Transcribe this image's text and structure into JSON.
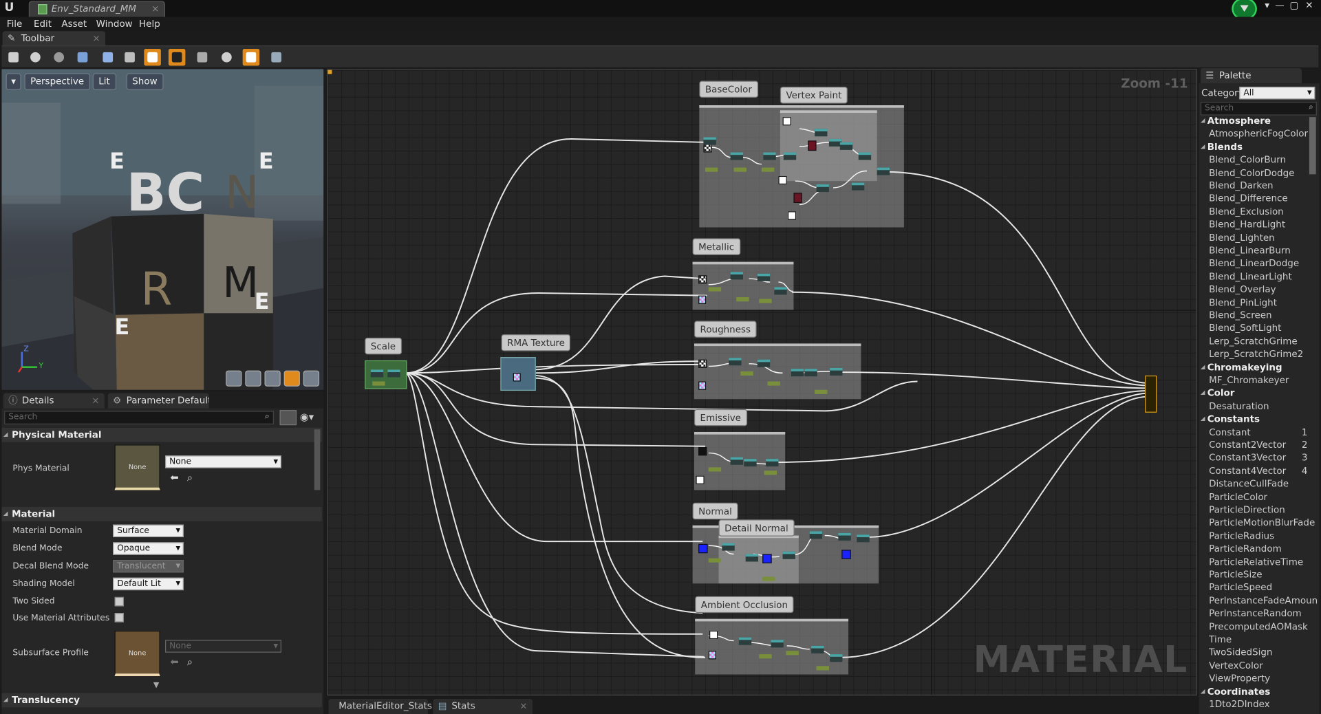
{
  "window": {
    "tab_title": "Env_Standard_MM",
    "controls": [
      "▾",
      "—",
      "▢",
      "✕"
    ]
  },
  "menu": [
    "File",
    "Edit",
    "Asset",
    "Window",
    "Help"
  ],
  "toolbar_tab": "Toolbar",
  "toolbar_buttons": [
    "save",
    "browse",
    "apply",
    "search",
    "home",
    "clean-up",
    "connectors",
    "live-preview",
    "live-nodes",
    "live-update",
    "stats",
    "platform-stats"
  ],
  "viewport": {
    "buttons": {
      "perspective": "Perspective",
      "lit": "Lit",
      "show": "Show"
    },
    "cube_letters": {
      "bc": "BC",
      "n": "N",
      "r": "R",
      "m": "M",
      "e": "E"
    },
    "axis": {
      "z": "Z",
      "y": "Y"
    }
  },
  "details": {
    "tabs": {
      "details": "Details",
      "param": "Parameter Defaults"
    },
    "search_placeholder": "Search",
    "physical_material_header": "Physical Material",
    "phys_material_label": "Phys Material",
    "phys_material_thumb": "None",
    "phys_material_value": "None",
    "material_header": "Material",
    "rows": [
      {
        "label": "Material Domain",
        "value": "Surface"
      },
      {
        "label": "Blend Mode",
        "value": "Opaque"
      },
      {
        "label": "Decal Blend Mode",
        "value": "Translucent"
      },
      {
        "label": "Shading Model",
        "value": "Default Lit"
      }
    ],
    "two_sided_label": "Two Sided",
    "use_material_attributes_label": "Use Material Attributes",
    "subsurface_label": "Subsurface Profile",
    "subsurface_thumb": "None",
    "subsurface_value": "None",
    "translucency_header": "Translucency"
  },
  "graph": {
    "zoom_label": "Zoom -11",
    "watermark": "MATERIAL",
    "labels": {
      "basecolor": "BaseColor",
      "vertexpaint": "Vertex Paint",
      "metallic": "Metallic",
      "roughness": "Roughness",
      "emissive": "Emissive",
      "normal": "Normal",
      "detailnormal": "Detail Normal",
      "ao": "Ambient Occlusion",
      "scale": "Scale",
      "rma": "RMA Texture"
    }
  },
  "bottom_tabs": {
    "stats_editor": "MaterialEditor_Stats",
    "stats": "Stats"
  },
  "palette": {
    "tab": "Palette",
    "category_label": "Category:",
    "category_value": "All",
    "search_placeholder": "Search",
    "groups": [
      {
        "name": "Atmosphere",
        "items": [
          "AtmosphericFogColor"
        ]
      },
      {
        "name": "Blends",
        "items": [
          "Blend_ColorBurn",
          "Blend_ColorDodge",
          "Blend_Darken",
          "Blend_Difference",
          "Blend_Exclusion",
          "Blend_HardLight",
          "Blend_Lighten",
          "Blend_LinearBurn",
          "Blend_LinearDodge",
          "Blend_LinearLight",
          "Blend_Overlay",
          "Blend_PinLight",
          "Blend_Screen",
          "Blend_SoftLight",
          "Lerp_ScratchGrime",
          "Lerp_ScratchGrime2"
        ]
      },
      {
        "name": "Chromakeying",
        "items": [
          "MF_Chromakeyer"
        ]
      },
      {
        "name": "Color",
        "items": [
          "Desaturation"
        ]
      },
      {
        "name": "Constants",
        "items": [
          "Constant",
          "Constant2Vector",
          "Constant3Vector",
          "Constant4Vector",
          "DistanceCullFade",
          "ParticleColor",
          "ParticleDirection",
          "ParticleMotionBlurFade",
          "ParticleRadius",
          "ParticleRandom",
          "ParticleRelativeTime",
          "ParticleSize",
          "ParticleSpeed",
          "PerInstanceFadeAmoun",
          "PerInstanceRandom",
          "PrecomputedAOMask",
          "Time",
          "TwoSidedSign",
          "VertexColor",
          "ViewProperty"
        ]
      },
      {
        "name": "Coordinates",
        "items": [
          "1Dto2DIndex"
        ]
      }
    ],
    "shortcuts": {
      "Constant": "1",
      "Constant2Vector": "2",
      "Constant3Vector": "3",
      "Constant4Vector": "4"
    }
  }
}
